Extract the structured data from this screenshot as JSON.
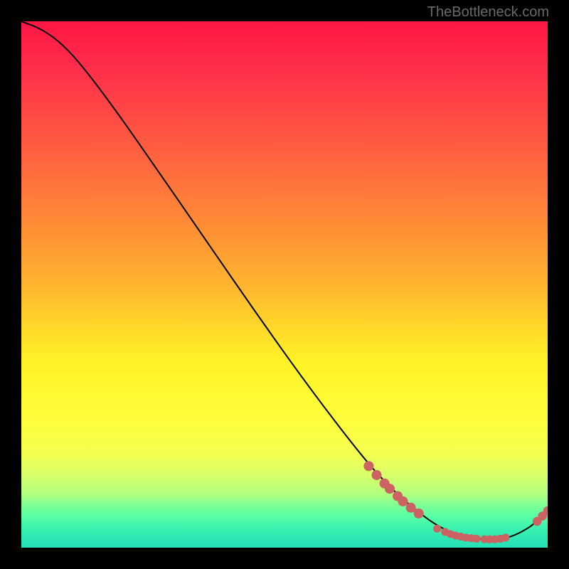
{
  "watermark": "TheBottleneck.com",
  "chart_data": {
    "type": "line",
    "title": "",
    "xlabel": "",
    "ylabel": "",
    "x_range": [
      0,
      100
    ],
    "y_range": [
      0,
      100
    ],
    "curve": [
      {
        "x": 0,
        "y": 100
      },
      {
        "x": 4,
        "y": 98.5
      },
      {
        "x": 8,
        "y": 95.5
      },
      {
        "x": 12,
        "y": 91
      },
      {
        "x": 18,
        "y": 83
      },
      {
        "x": 25,
        "y": 73
      },
      {
        "x": 35,
        "y": 58.5
      },
      {
        "x": 45,
        "y": 44
      },
      {
        "x": 55,
        "y": 30
      },
      {
        "x": 65,
        "y": 17
      },
      {
        "x": 70,
        "y": 11.5
      },
      {
        "x": 75,
        "y": 7
      },
      {
        "x": 80,
        "y": 3.5
      },
      {
        "x": 85,
        "y": 1.8
      },
      {
        "x": 90,
        "y": 1.5
      },
      {
        "x": 93,
        "y": 2.0
      },
      {
        "x": 96,
        "y": 3.5
      },
      {
        "x": 98,
        "y": 5.0
      },
      {
        "x": 100,
        "y": 7.0
      }
    ],
    "markers_upper": [
      {
        "x": 66.0,
        "y": 15.5
      },
      {
        "x": 67.5,
        "y": 13.8
      },
      {
        "x": 69.0,
        "y": 12.2
      },
      {
        "x": 70.0,
        "y": 11.2
      },
      {
        "x": 71.5,
        "y": 9.8
      },
      {
        "x": 72.5,
        "y": 8.8
      },
      {
        "x": 74.0,
        "y": 7.6
      },
      {
        "x": 75.5,
        "y": 6.5
      }
    ],
    "markers_valley": [
      {
        "x": 79.0,
        "y": 3.6
      },
      {
        "x": 80.5,
        "y": 3.0
      },
      {
        "x": 81.5,
        "y": 2.6
      },
      {
        "x": 82.5,
        "y": 2.3
      },
      {
        "x": 83.5,
        "y": 2.1
      },
      {
        "x": 84.5,
        "y": 1.9
      },
      {
        "x": 85.5,
        "y": 1.8
      },
      {
        "x": 86.5,
        "y": 1.7
      },
      {
        "x": 88.0,
        "y": 1.6
      },
      {
        "x": 89.0,
        "y": 1.6
      },
      {
        "x": 90.0,
        "y": 1.6
      },
      {
        "x": 91.0,
        "y": 1.7
      },
      {
        "x": 92.0,
        "y": 1.9
      }
    ],
    "markers_rise": [
      {
        "x": 98.0,
        "y": 5.0
      },
      {
        "x": 99.0,
        "y": 6.0
      },
      {
        "x": 100.0,
        "y": 7.0
      }
    ],
    "marker_color": "#cc6262",
    "curve_color": "#000000",
    "gradient": {
      "top": "#ff1744",
      "mid": "#ffeb3b",
      "bottom": "#24e1b6"
    }
  }
}
